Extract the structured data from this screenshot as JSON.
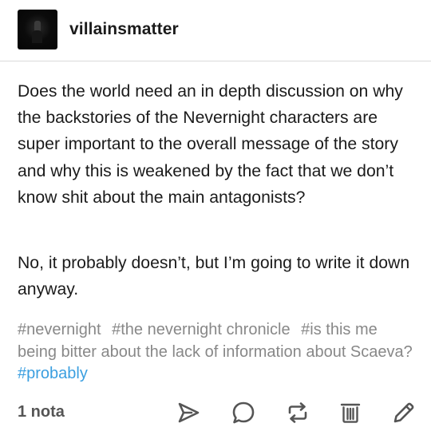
{
  "post": {
    "username": "villainsmatter",
    "paragraph1": "Does the world need an in depth discussion on why the backstories of the Nevernight characters are super important to the overall message of the story and why this is weakened by the fact that we don’t know shit about the main antagonists?",
    "paragraph2": "No, it probably doesn’t, but I’m going to write it down anyway.",
    "tags": [
      "#nevernight",
      "#the nevernight chronicle",
      "#is this me being bitter about the lack of information about Scaeva?",
      "#probably"
    ]
  },
  "footer": {
    "notes_label": "1 nota",
    "icons": [
      "share-icon",
      "reply-icon",
      "reblog-icon",
      "delete-icon",
      "edit-icon"
    ]
  },
  "colors": {
    "text": "#1b1b1b",
    "tag": "#888888",
    "tag_highlight": "#3b9fe0",
    "icon": "#555555"
  }
}
